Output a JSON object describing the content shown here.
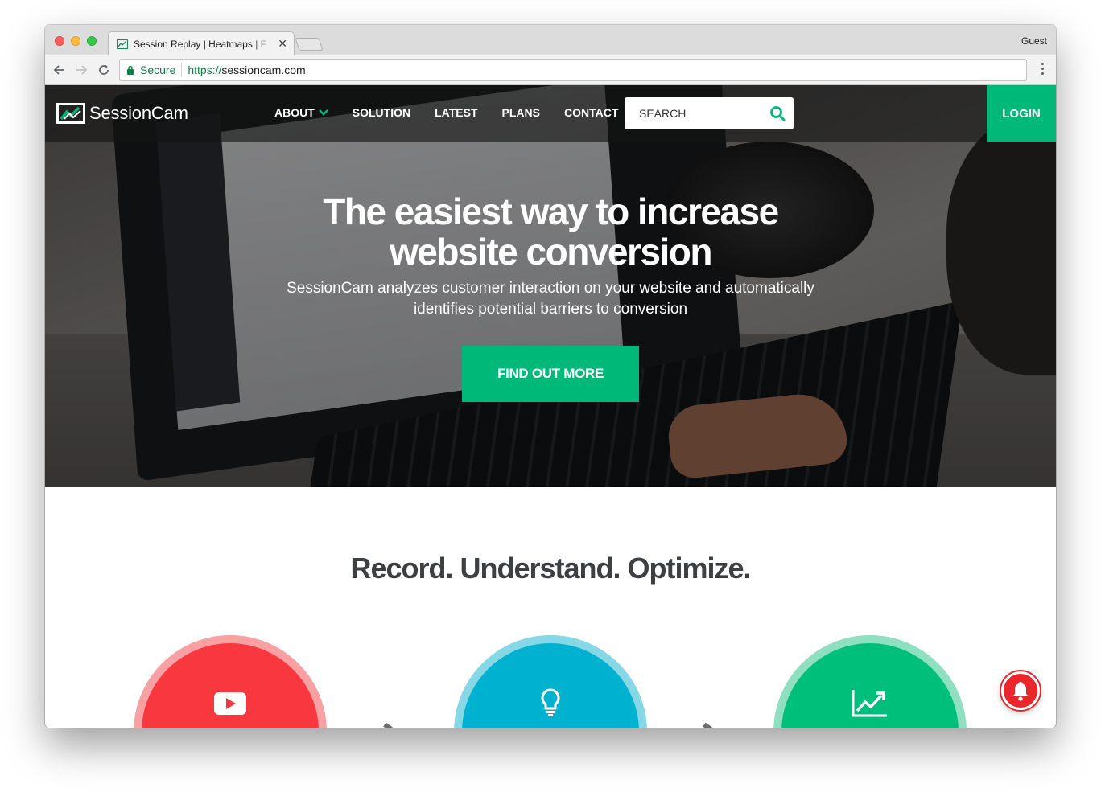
{
  "browser": {
    "tab_title": "Session Replay | Heatmaps | F",
    "profile": "Guest",
    "secure_label": "Secure",
    "url_scheme": "https://",
    "url_host": "sessioncam.com"
  },
  "site": {
    "logo_text": "SessionCam",
    "menu": [
      {
        "label": "ABOUT"
      },
      {
        "label": "SOLUTION"
      },
      {
        "label": "LATEST"
      },
      {
        "label": "PLANS"
      },
      {
        "label": "CONTACT"
      }
    ],
    "search_placeholder": "SEARCH",
    "login_label": "LOGIN"
  },
  "hero": {
    "title": "The easiest way to increase website conversion",
    "subtitle": "SessionCam analyzes customer interaction on your website and automatically identifies potential barriers to conversion",
    "cta_label": "FIND OUT MORE"
  },
  "features": {
    "title": "Record. Understand. Optimize.",
    "items": [
      {
        "icon": "play-icon",
        "color": "#f9373e"
      },
      {
        "icon": "lightbulb-icon",
        "color": "#00b2cf"
      },
      {
        "icon": "trend-chart-icon",
        "color": "#00bf7b"
      }
    ]
  },
  "colors": {
    "brand_green": "#00b979",
    "bell_red": "#e9262c"
  }
}
